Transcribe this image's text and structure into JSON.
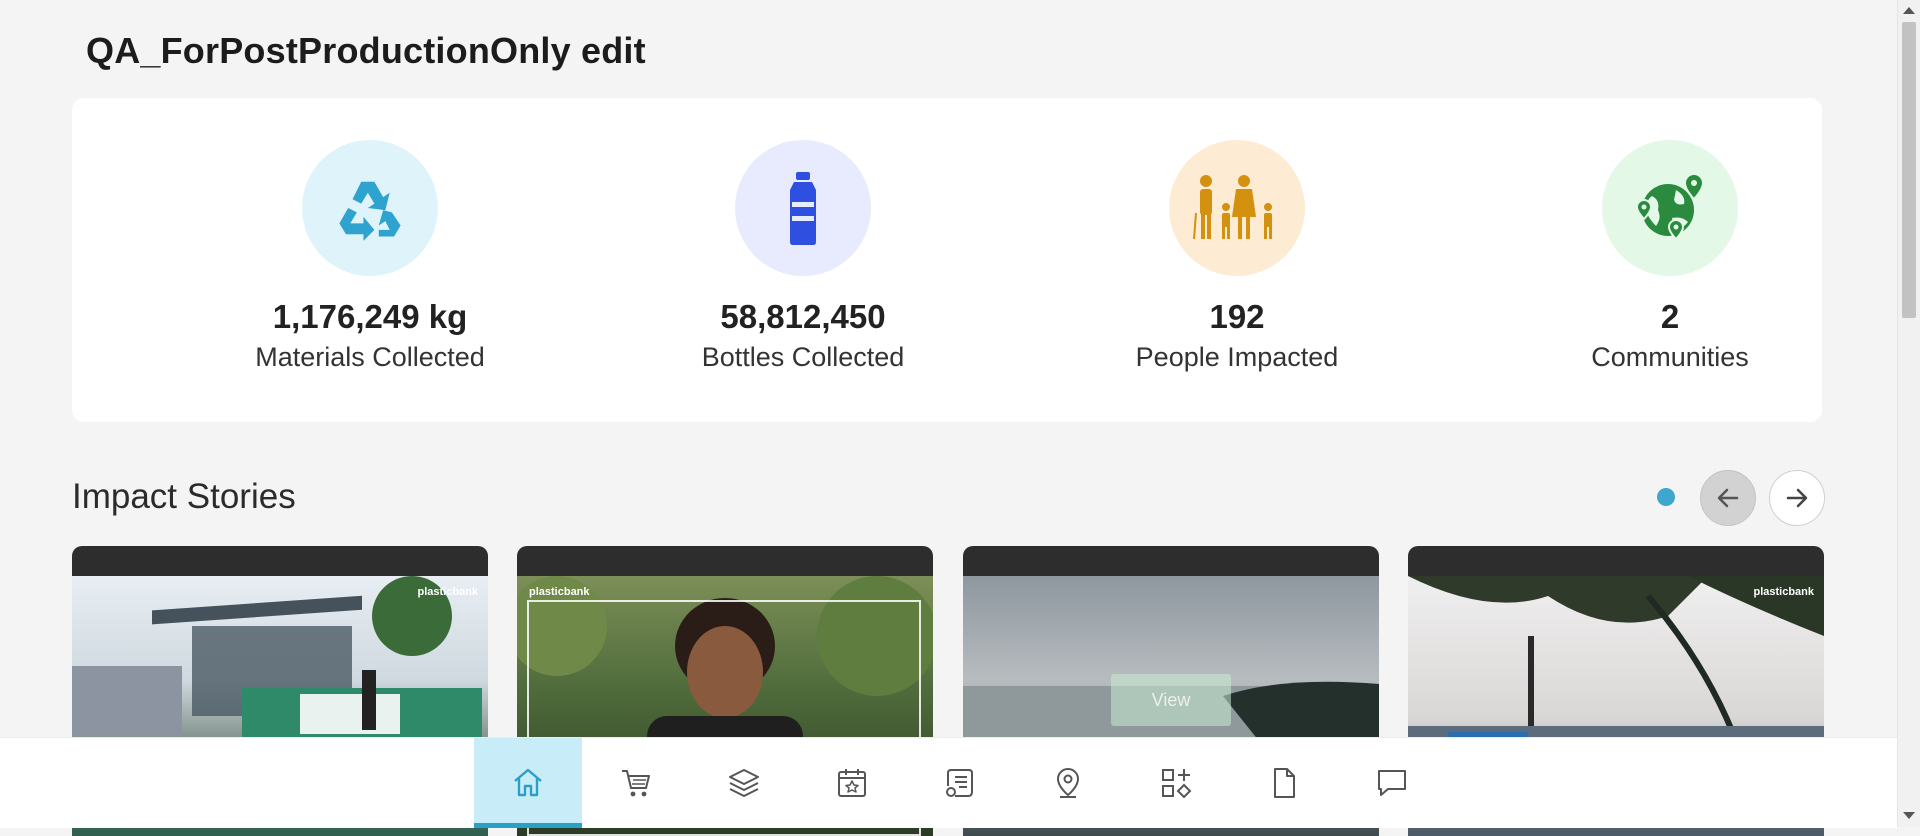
{
  "page": {
    "title": "QA_ForPostProductionOnly edit"
  },
  "stats": [
    {
      "value": "1,176,249 kg",
      "label": "Materials Collected",
      "icon": "recycle-icon",
      "bg": "#dff3fb",
      "color": "#2ea3cf"
    },
    {
      "value": "58,812,450",
      "label": "Bottles Collected",
      "icon": "bottle-icon",
      "bg": "#e7ebfd",
      "color": "#2f4fe0"
    },
    {
      "value": "192",
      "label": "People Impacted",
      "icon": "family-icon",
      "bg": "#fdecd3",
      "color": "#d4900f"
    },
    {
      "value": "2",
      "label": "Communities",
      "icon": "globe-pins-icon",
      "bg": "#e3f8e7",
      "color": "#2a8a3d"
    }
  ],
  "impact_stories": {
    "title": "Impact Stories",
    "cards": [
      {
        "brand": "plasticbank"
      },
      {
        "brand": "plasticbank"
      },
      {
        "overlay_label": "View"
      },
      {
        "brand": "plasticbank"
      }
    ]
  },
  "bottom_nav": {
    "items": [
      {
        "icon": "home-icon",
        "active": true
      },
      {
        "icon": "cart-icon",
        "active": false
      },
      {
        "icon": "layers-icon",
        "active": false
      },
      {
        "icon": "calendar-star-icon",
        "active": false
      },
      {
        "icon": "certificate-icon",
        "active": false
      },
      {
        "icon": "location-pin-icon",
        "active": false
      },
      {
        "icon": "widgets-icon",
        "active": false
      },
      {
        "icon": "document-icon",
        "active": false
      },
      {
        "icon": "chat-icon",
        "active": false
      }
    ]
  }
}
